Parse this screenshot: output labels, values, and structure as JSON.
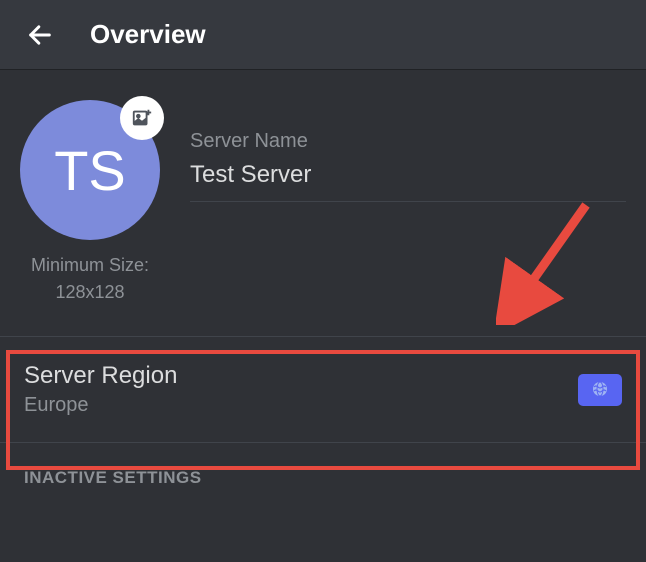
{
  "header": {
    "title": "Overview"
  },
  "avatar": {
    "initials": "TS",
    "min_size_label": "Minimum Size:",
    "min_size_value": "128x128"
  },
  "server_name": {
    "label": "Server Name",
    "value": "Test Server"
  },
  "region": {
    "title": "Server Region",
    "value": "Europe"
  },
  "sections": {
    "inactive": "INACTIVE SETTINGS"
  }
}
